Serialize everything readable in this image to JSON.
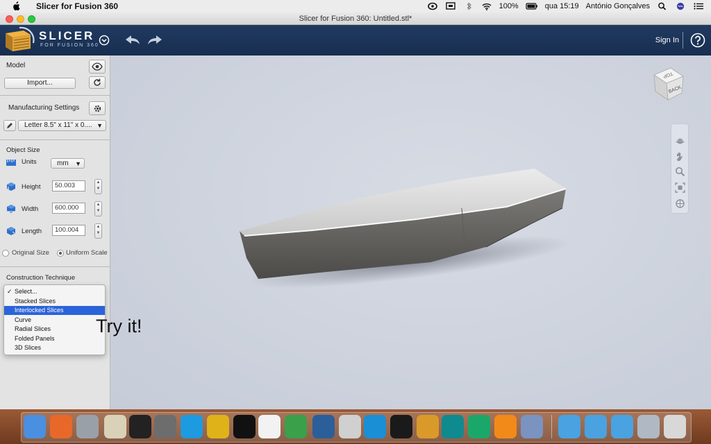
{
  "menubar": {
    "app_name": "Slicer for Fusion 360",
    "battery": "100%",
    "clock": "qua 15:19",
    "user": "António Gonçalves"
  },
  "window": {
    "title": "Slicer for Fusion 360: Untitled.stl*"
  },
  "header": {
    "brand": "SLICER",
    "brand_sub": "FOR FUSION 360",
    "sign_in": "Sign In"
  },
  "panel": {
    "model_label": "Model",
    "import_button": "Import...",
    "manufacturing_label": "Manufacturing Settings",
    "sheet_select": "Letter 8.5\" x 11\" x 0....",
    "object_size_label": "Object Size",
    "units_label": "Units",
    "units_value": "mm",
    "height_label": "Height",
    "height_value": "50.003",
    "width_label": "Width",
    "width_value": "600.000",
    "length_label": "Length",
    "length_value": "100.004",
    "original_size": "Original Size",
    "uniform_scale": "Uniform Scale",
    "construction_label": "Construction Technique"
  },
  "construction_options": [
    "Select...",
    "Stacked Slices",
    "Interlocked Slices",
    "Curve",
    "Radial Slices",
    "Folded Panels",
    "3D Slices"
  ],
  "construction_checked": "Select...",
  "construction_highlighted": "Interlocked Slices",
  "annotation": "Try it!",
  "viewcube": {
    "top": "TOP",
    "back": "BACK"
  },
  "colors": {
    "header_bg": "#1d3557",
    "panel_bg": "#e3e3e3",
    "viewport_bg": "#c9cfdc",
    "selection": "#2b64d9",
    "model": "#6b6a66"
  },
  "dock_icons": [
    "finder-icon",
    "firefox-icon",
    "system-prefs-icon",
    "textedit-icon",
    "inkscape-icon",
    "calculator-icon",
    "skype-icon",
    "blender-icon",
    "processing-icon",
    "preview-icon",
    "maps-icon",
    "video-editor-icon",
    "instruments-icon",
    "c-icon",
    "terminal-icon",
    "tool-icon",
    "arduino-icon",
    "atom-icon",
    "fusion360-icon",
    "slicer-icon",
    "folder-icon",
    "downloads-icon",
    "folder2-icon",
    "scanner-icon",
    "trash-icon"
  ]
}
